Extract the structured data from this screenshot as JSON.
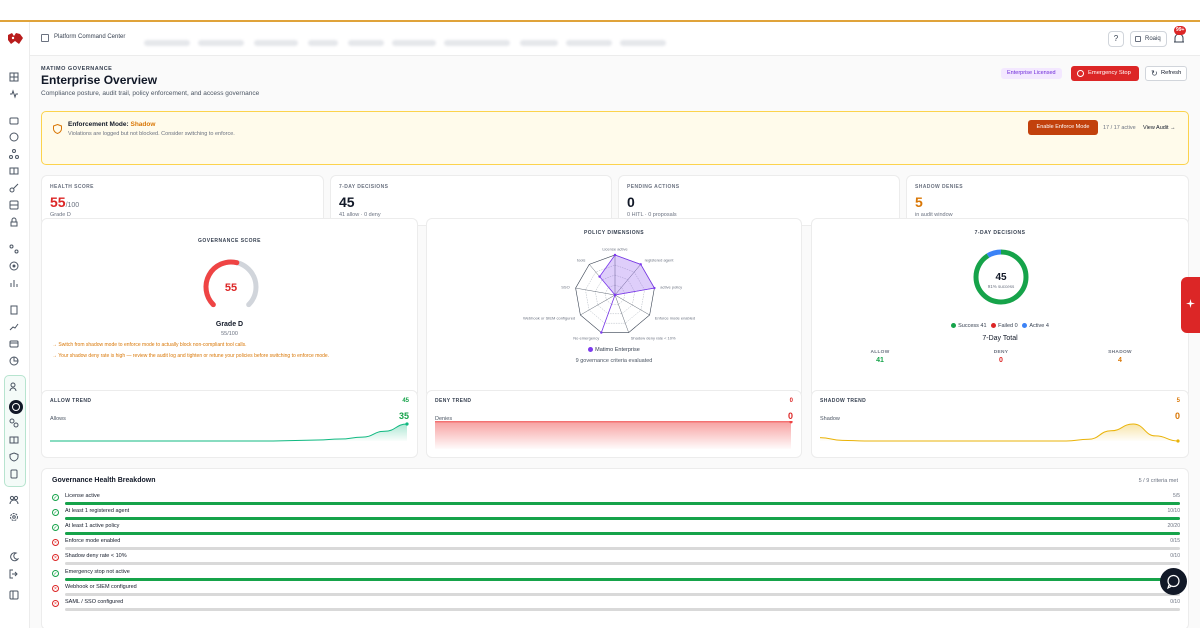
{
  "header": {
    "title": "Platform Command Center",
    "help_glyph": "?",
    "user_name": "Roaiq",
    "notification_count": "99+"
  },
  "page": {
    "eyebrow": "MATIMO GOVERNANCE",
    "title": "Enterprise Overview",
    "subtitle": "Compliance posture, audit trail, policy enforcement, and access governance",
    "badge": "Enterprise Licensed",
    "emergency_stop": "Emergency Stop",
    "refresh": "Refresh"
  },
  "banner": {
    "title_prefix": "Enforcement Mode: ",
    "mode": "Shadow",
    "subtitle": "Violations are logged but not blocked. Consider switching to enforce.",
    "enable_button": "Enable Enforce Mode",
    "active_count": "17 / 17 active",
    "view_audit": "View Audit →"
  },
  "stats": [
    {
      "label": "HEALTH SCORE",
      "value": "55",
      "suffix": "/100",
      "sub": "Grade D"
    },
    {
      "label": "7-DAY DECISIONS",
      "value": "45",
      "suffix": "",
      "sub": "41 allow · 0 deny"
    },
    {
      "label": "PENDING ACTIONS",
      "value": "0",
      "suffix": "",
      "sub": "0 HITL · 0 proposals"
    },
    {
      "label": "SHADOW DENIES",
      "value": "5",
      "suffix": "",
      "sub": "in audit window"
    }
  ],
  "governance": {
    "title": "GOVERNANCE SCORE",
    "score": 55,
    "score_label": "55",
    "grade": "Grade D",
    "score_text": "55/100",
    "tips": [
      "→ Switch from shadow mode to enforce mode to actually block non-compliant tool calls.",
      "→ Your shadow deny rate is high — review the audit log and tighten or retune your policies before switching to enforce mode."
    ]
  },
  "policy": {
    "title": "POLICY DIMENSIONS",
    "legend": "Matimo Enterprise",
    "footer": "9 governance criteria evaluated",
    "color": "#7c3aed"
  },
  "decisions": {
    "title": "7-DAY DECISIONS",
    "total": "45",
    "total_sub": "91% success",
    "legend": [
      "Success 41",
      "Failed 0",
      "Active 4"
    ],
    "subtitle": "7-Day Total",
    "cols": [
      {
        "label": "ALLOW",
        "value": "41"
      },
      {
        "label": "DENY",
        "value": "0"
      },
      {
        "label": "SHADOW",
        "value": "4"
      }
    ]
  },
  "trends": [
    {
      "label": "ALLOW TREND",
      "total": "45",
      "series": "Allows",
      "last": "35",
      "color": "#10b981"
    },
    {
      "label": "DENY TREND",
      "total": "0",
      "series": "Denies",
      "last": "0",
      "color": "#ef4444"
    },
    {
      "label": "SHADOW TREND",
      "total": "5",
      "series": "Shadow",
      "last": "0",
      "color": "#eab308"
    }
  ],
  "breakdown": {
    "title": "Governance Health Breakdown",
    "met": "5 / 9 criteria met",
    "rows": [
      {
        "name": "License active",
        "score": "5/5",
        "fraction": 1,
        "ok": true
      },
      {
        "name": "At least 1 registered agent",
        "score": "10/10",
        "fraction": 1,
        "ok": true
      },
      {
        "name": "At least 1 active policy",
        "score": "20/20",
        "fraction": 1,
        "ok": true
      },
      {
        "name": "Enforce mode enabled",
        "score": "0/15",
        "fraction": 0,
        "ok": false
      },
      {
        "name": "Shadow deny rate < 10%",
        "score": "0/10",
        "fraction": 0,
        "ok": false
      },
      {
        "name": "Emergency stop not active",
        "score": "",
        "fraction": 1,
        "ok": true
      },
      {
        "name": "Webhook or SIEM configured",
        "score": "",
        "fraction": 0,
        "ok": false
      },
      {
        "name": "SAML / SSO configured",
        "score": "0/10",
        "fraction": 0,
        "ok": false
      }
    ]
  },
  "chart_data": [
    {
      "type": "radar",
      "title": "POLICY DIMENSIONS",
      "categories": [
        "License active",
        "registered agent",
        "active policy",
        "Enforce mode enabled",
        "Shadow deny rate < 10%",
        "No emergency",
        "Webhook or SIEM configured",
        "SSO",
        "tools"
      ],
      "series": [
        {
          "name": "Matimo Enterprise",
          "values": [
            100,
            100,
            100,
            0,
            0,
            100,
            0,
            0,
            60
          ]
        }
      ],
      "rlim": [
        0,
        100
      ]
    },
    {
      "type": "pie",
      "title": "7-DAY DECISIONS",
      "categories": [
        "Success",
        "Failed",
        "Active"
      ],
      "values": [
        41,
        0,
        4
      ],
      "colors": [
        "#16a34a",
        "#dc2626",
        "#3b82f6"
      ]
    },
    {
      "type": "area",
      "title": "ALLOW TREND",
      "series": [
        {
          "name": "Allows",
          "values": [
            0,
            0,
            0,
            0,
            0,
            0,
            0,
            0,
            0,
            0,
            0,
            1,
            2,
            4,
            8,
            20,
            35
          ]
        }
      ]
    },
    {
      "type": "area",
      "title": "DENY TREND",
      "series": [
        {
          "name": "Denies",
          "values": [
            0,
            0,
            0,
            0,
            0,
            0,
            0,
            0,
            0,
            0,
            0,
            0,
            0,
            0,
            0,
            0,
            0
          ]
        }
      ]
    },
    {
      "type": "area",
      "title": "SHADOW TREND",
      "series": [
        {
          "name": "Shadow",
          "values": [
            1,
            0.2,
            0,
            0,
            0,
            0,
            0,
            0,
            0,
            0,
            0,
            0,
            0.5,
            3,
            5,
            1.5,
            0
          ]
        }
      ]
    }
  ]
}
